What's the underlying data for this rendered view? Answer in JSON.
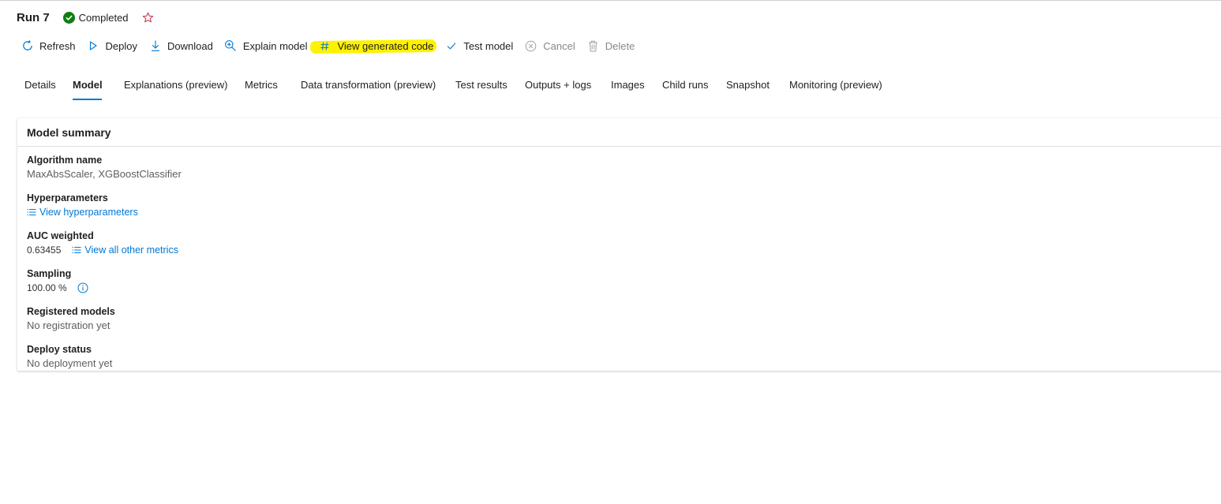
{
  "header": {
    "title": "Run 7",
    "status": "Completed",
    "status_color": "#107c10",
    "favorite_icon": "star-icon"
  },
  "toolbar": {
    "refresh": "Refresh",
    "deploy": "Deploy",
    "download": "Download",
    "explain": "Explain model",
    "view_code": "View generated code",
    "test_model": "Test model",
    "cancel": "Cancel",
    "delete": "Delete",
    "highlight_color": "#fff200"
  },
  "tabs": [
    "Details",
    "Model",
    "Explanations (preview)",
    "Metrics",
    "Data transformation (preview)",
    "Test results",
    "Outputs + logs",
    "Images",
    "Child runs",
    "Snapshot",
    "Monitoring (preview)"
  ],
  "active_tab": "Model",
  "model_summary": {
    "title": "Model summary",
    "algorithm_label": "Algorithm name",
    "algorithm_value": "MaxAbsScaler, XGBoostClassifier",
    "hyper_label": "Hyperparameters",
    "hyper_link": "View hyperparameters",
    "auc_label": "AUC weighted",
    "auc_value": "0.63455",
    "metrics_link": "View all other metrics",
    "sampling_label": "Sampling",
    "sampling_value": "100.00 %",
    "registered_label": "Registered models",
    "registered_value": "No registration yet",
    "deploy_label": "Deploy status",
    "deploy_value": "No deployment yet"
  },
  "colors": {
    "accent": "#0078d4",
    "text": "#201f1e",
    "muted": "#605e5c",
    "disabled": "#8a8886"
  }
}
